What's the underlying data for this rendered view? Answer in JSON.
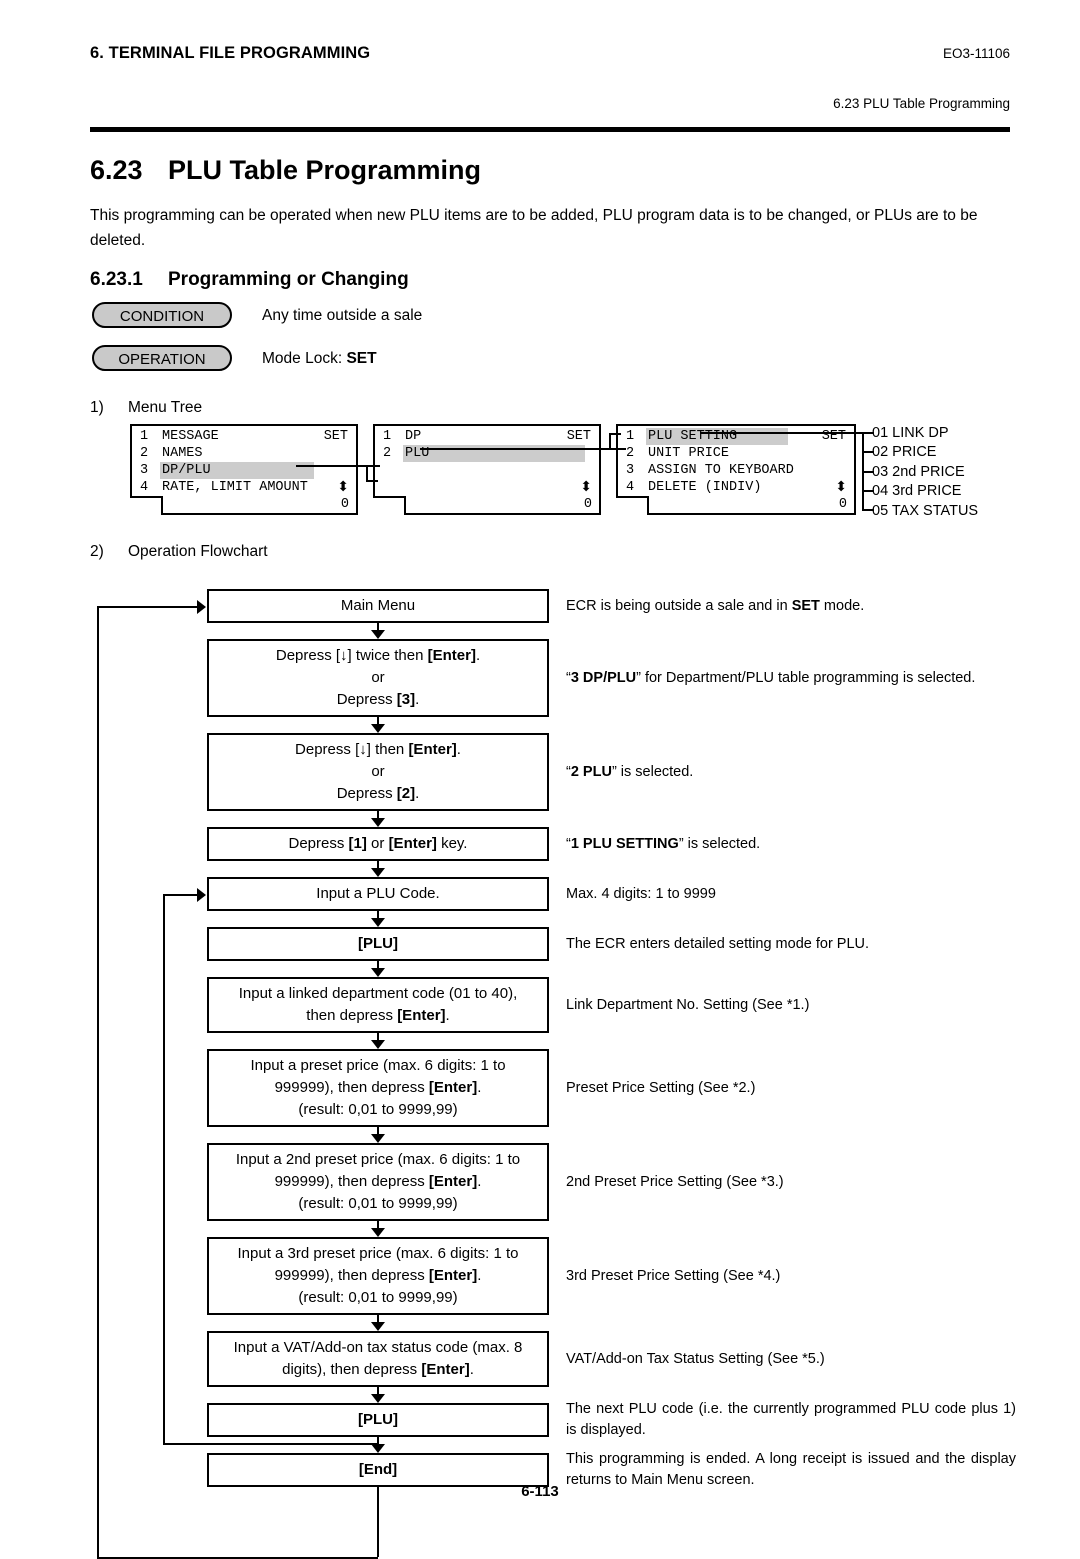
{
  "header": {
    "chapter": "6. TERMINAL FILE PROGRAMMING",
    "doc_id": "EO3-11106",
    "section_running": "6.23 PLU Table Programming"
  },
  "title": {
    "number": "6.23",
    "text": "PLU Table Programming",
    "intro": "This programming can be operated when new PLU items are to be added, PLU program data is to be changed, or PLUs are to be deleted.",
    "sub_number": "6.23.1",
    "sub_text": "Programming or Changing"
  },
  "badges": {
    "condition_label": "CONDITION",
    "condition_text": "Any time outside a sale",
    "operation_label": "OPERATION",
    "operation_text_prefix": "Mode Lock: ",
    "operation_text_bold": "SET"
  },
  "steps": {
    "one_num": "1)",
    "one_label": "Menu Tree",
    "two_num": "2)",
    "two_label": "Operation Flowchart"
  },
  "menu_tree": {
    "screen1": {
      "lines": [
        {
          "idx": "1",
          "text": "MESSAGE",
          "right": "SET",
          "highlight": false
        },
        {
          "idx": "2",
          "text": "NAMES",
          "right": "",
          "highlight": false
        },
        {
          "idx": "3",
          "text": "DP/PLU",
          "right": "",
          "highlight": true
        },
        {
          "idx": "4",
          "text": "RATE, LIMIT AMOUNT",
          "right": "",
          "highlight": false
        }
      ],
      "scroll_icon": "arrows-up-down-icon",
      "status": "0"
    },
    "screen2": {
      "lines": [
        {
          "idx": "1",
          "text": "DP",
          "right": "SET",
          "highlight": false
        },
        {
          "idx": "2",
          "text": "PLU",
          "right": "",
          "highlight": true
        },
        {
          "idx": "",
          "text": "",
          "right": "",
          "highlight": false
        },
        {
          "idx": "",
          "text": "",
          "right": "",
          "highlight": false
        }
      ],
      "scroll_icon": "arrows-up-down-icon",
      "status": "0"
    },
    "screen3": {
      "lines": [
        {
          "idx": "1",
          "text": "PLU SETTING",
          "right": "SET",
          "highlight": true
        },
        {
          "idx": "2",
          "text": "UNIT PRICE",
          "right": "",
          "highlight": false
        },
        {
          "idx": "3",
          "text": "ASSIGN TO KEYBOARD",
          "right": "",
          "highlight": false
        },
        {
          "idx": "4",
          "text": "DELETE (INDIV)",
          "right": "",
          "highlight": false
        }
      ],
      "scroll_icon": "arrows-up-down-icon",
      "status": "0"
    },
    "detail_list": [
      "01 LINK DP",
      "02 PRICE",
      "03 2nd PRICE",
      "04 3rd PRICE",
      "05 TAX STATUS"
    ]
  },
  "flowchart": [
    {
      "id": "main-menu",
      "lines": [
        {
          "t": "Main Menu"
        }
      ],
      "note": [
        {
          "t": "ECR is being outside a sale and in "
        },
        {
          "t": "SET",
          "b": true
        },
        {
          "t": " mode."
        }
      ]
    },
    {
      "id": "depress-down-twice",
      "lines": [
        {
          "t": "Depress [↓] twice then [Enter]."
        },
        {
          "t": "or"
        },
        {
          "t": "Depress [3]."
        }
      ],
      "note": [
        {
          "t": "“"
        },
        {
          "t": "3 DP/PLU",
          "b": true
        },
        {
          "t": "” for Department/PLU table programming is selected."
        }
      ]
    },
    {
      "id": "depress-down-once",
      "lines": [
        {
          "t": "Depress [↓] then [Enter]."
        },
        {
          "t": "or"
        },
        {
          "t": "Depress [2]."
        }
      ],
      "note": [
        {
          "t": "“"
        },
        {
          "t": "2 PLU",
          "b": true
        },
        {
          "t": "” is selected."
        }
      ]
    },
    {
      "id": "depress-1-or-enter",
      "lines": [
        {
          "t": "Depress [1] or [Enter] key."
        }
      ],
      "note": [
        {
          "t": "“"
        },
        {
          "t": "1 PLU SETTING",
          "b": true
        },
        {
          "t": "” is selected."
        }
      ]
    },
    {
      "id": "input-plu-code",
      "lines": [
        {
          "t": "Input a PLU Code."
        }
      ],
      "note": [
        {
          "t": "Max. 4 digits: 1 to 9999"
        }
      ]
    },
    {
      "id": "plu-key-1",
      "lines": [
        {
          "t": "[PLU]",
          "b": true
        }
      ],
      "note": [
        {
          "t": "The ECR enters detailed setting mode for PLU."
        }
      ]
    },
    {
      "id": "input-linked-dept",
      "lines": [
        {
          "t": "Input a linked department code (01 to 40),"
        },
        {
          "t": "then depress [Enter]."
        }
      ],
      "note": [
        {
          "t": "Link Department No. Setting (See *1.)"
        }
      ]
    },
    {
      "id": "input-preset-price",
      "lines": [
        {
          "t": "Input a preset price (max. 6 digits: 1 to"
        },
        {
          "t": "999999), then depress [Enter]."
        },
        {
          "t": "(result: 0,01 to 9999,99)"
        }
      ],
      "note": [
        {
          "t": "Preset Price Setting (See *2.)"
        }
      ]
    },
    {
      "id": "input-2nd-preset-price",
      "lines": [
        {
          "t": "Input a 2nd preset price (max. 6 digits: 1 to"
        },
        {
          "t": "999999), then depress [Enter]."
        },
        {
          "t": "(result: 0,01 to 9999,99)"
        }
      ],
      "note": [
        {
          "t": "2nd Preset Price Setting (See *3.)"
        }
      ]
    },
    {
      "id": "input-3rd-preset-price",
      "lines": [
        {
          "t": "Input a 3rd preset price (max. 6 digits: 1 to"
        },
        {
          "t": "999999), then depress [Enter]."
        },
        {
          "t": "(result: 0,01 to 9999,99)"
        }
      ],
      "note": [
        {
          "t": "3rd Preset Price Setting (See *4.)"
        }
      ]
    },
    {
      "id": "input-vat-tax-status",
      "lines": [
        {
          "t": "Input a VAT/Add-on tax status code (max. 8"
        },
        {
          "t": "digits), then depress [Enter]."
        }
      ],
      "note": [
        {
          "t": "VAT/Add-on Tax Status Setting (See *5.)"
        }
      ]
    },
    {
      "id": "plu-key-2",
      "lines": [
        {
          "t": "[PLU]",
          "b": true
        }
      ],
      "note": [
        {
          "t": "The next PLU code (i.e. the currently programmed PLU code plus 1) is displayed."
        }
      ]
    },
    {
      "id": "end",
      "lines": [
        {
          "t": "[End]",
          "b": true
        }
      ],
      "note": [
        {
          "t": "This programming is ended.  A long receipt is issued and the display returns to Main Menu screen."
        }
      ]
    }
  ],
  "footer": {
    "page": "6-113"
  }
}
